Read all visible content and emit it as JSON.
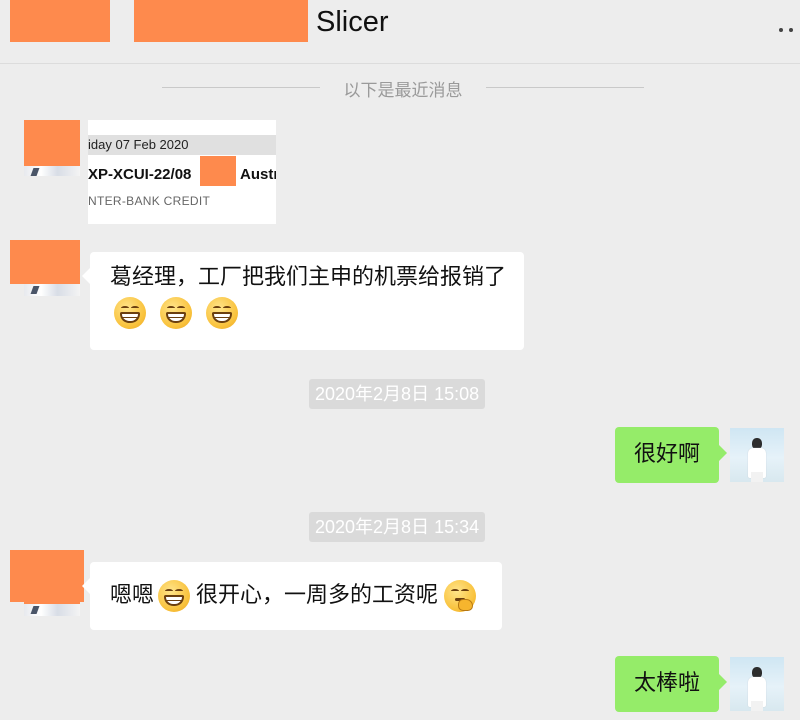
{
  "header": {
    "title": "Slicer",
    "more_icon": "ellipsis-icon"
  },
  "divider": {
    "label": "以下是最近消息"
  },
  "messages": {
    "image_card": {
      "date_line": "iday 07 Feb 2020",
      "ref_line": "XP-XCUI-22/08",
      "ref_suffix": "Austr",
      "type_line": "NTER-BANK CREDIT"
    },
    "m1": {
      "text": "葛经理，工厂把我们主申的机票给报销了",
      "emojis": [
        "grin-emoji",
        "grin-emoji",
        "grin-emoji"
      ]
    },
    "ts1": "2020年2月8日 15:08",
    "m2": {
      "text": "很好啊"
    },
    "ts2": "2020年2月8日 15:34",
    "m3": {
      "prefix": "嗯嗯",
      "text": "很开心，一周多的工资呢",
      "emojis": [
        "grin-emoji",
        "hmm-emoji"
      ]
    },
    "m4": {
      "text": "太棒啦"
    }
  },
  "colors": {
    "background": "#ededed",
    "bubble_self": "#95ec69",
    "bubble_other": "#ffffff",
    "redaction": "#fe8a4d",
    "timestamp_bg": "#dadada"
  }
}
